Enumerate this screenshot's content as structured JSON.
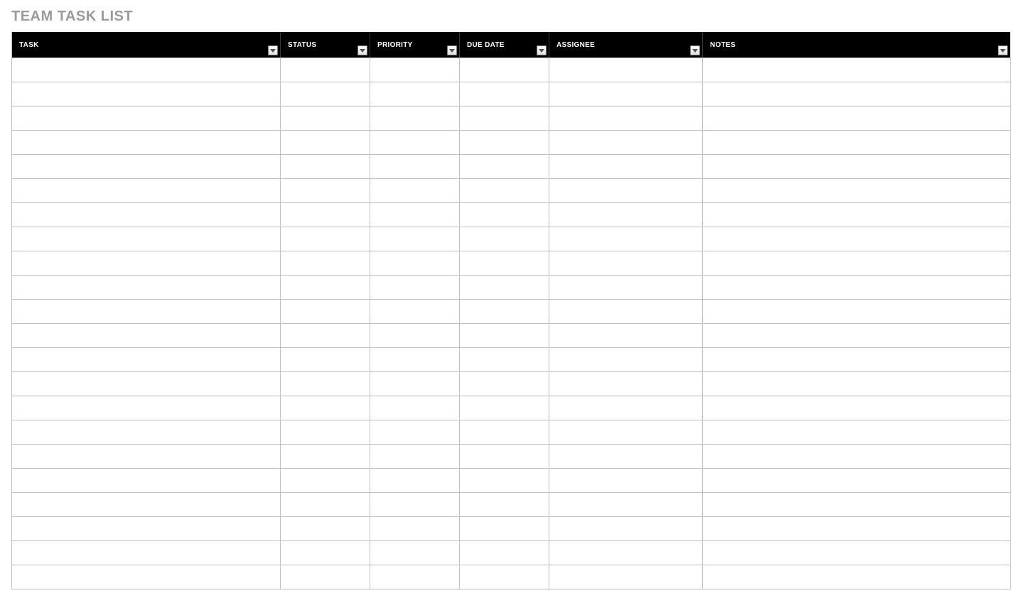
{
  "title": "TEAM TASK LIST",
  "columns": [
    {
      "key": "task",
      "label": "TASK",
      "filter": true
    },
    {
      "key": "status",
      "label": "STATUS",
      "filter": true
    },
    {
      "key": "priority",
      "label": "PRIORITY",
      "filter": true
    },
    {
      "key": "due",
      "label": "DUE DATE",
      "filter": true
    },
    {
      "key": "assignee",
      "label": "ASSIGNEE",
      "filter": true
    },
    {
      "key": "notes",
      "label": "NOTES",
      "filter": true
    }
  ],
  "rows": [
    {
      "task": "",
      "status": "",
      "priority": "",
      "due": "",
      "assignee": "",
      "notes": ""
    },
    {
      "task": "",
      "status": "",
      "priority": "",
      "due": "",
      "assignee": "",
      "notes": ""
    },
    {
      "task": "",
      "status": "",
      "priority": "",
      "due": "",
      "assignee": "",
      "notes": ""
    },
    {
      "task": "",
      "status": "",
      "priority": "",
      "due": "",
      "assignee": "",
      "notes": ""
    },
    {
      "task": "",
      "status": "",
      "priority": "",
      "due": "",
      "assignee": "",
      "notes": ""
    },
    {
      "task": "",
      "status": "",
      "priority": "",
      "due": "",
      "assignee": "",
      "notes": ""
    },
    {
      "task": "",
      "status": "",
      "priority": "",
      "due": "",
      "assignee": "",
      "notes": ""
    },
    {
      "task": "",
      "status": "",
      "priority": "",
      "due": "",
      "assignee": "",
      "notes": ""
    },
    {
      "task": "",
      "status": "",
      "priority": "",
      "due": "",
      "assignee": "",
      "notes": ""
    },
    {
      "task": "",
      "status": "",
      "priority": "",
      "due": "",
      "assignee": "",
      "notes": ""
    },
    {
      "task": "",
      "status": "",
      "priority": "",
      "due": "",
      "assignee": "",
      "notes": ""
    },
    {
      "task": "",
      "status": "",
      "priority": "",
      "due": "",
      "assignee": "",
      "notes": ""
    },
    {
      "task": "",
      "status": "",
      "priority": "",
      "due": "",
      "assignee": "",
      "notes": ""
    },
    {
      "task": "",
      "status": "",
      "priority": "",
      "due": "",
      "assignee": "",
      "notes": ""
    },
    {
      "task": "",
      "status": "",
      "priority": "",
      "due": "",
      "assignee": "",
      "notes": ""
    },
    {
      "task": "",
      "status": "",
      "priority": "",
      "due": "",
      "assignee": "",
      "notes": ""
    },
    {
      "task": "",
      "status": "",
      "priority": "",
      "due": "",
      "assignee": "",
      "notes": ""
    },
    {
      "task": "",
      "status": "",
      "priority": "",
      "due": "",
      "assignee": "",
      "notes": ""
    },
    {
      "task": "",
      "status": "",
      "priority": "",
      "due": "",
      "assignee": "",
      "notes": ""
    },
    {
      "task": "",
      "status": "",
      "priority": "",
      "due": "",
      "assignee": "",
      "notes": ""
    },
    {
      "task": "",
      "status": "",
      "priority": "",
      "due": "",
      "assignee": "",
      "notes": ""
    },
    {
      "task": "",
      "status": "",
      "priority": "",
      "due": "",
      "assignee": "",
      "notes": ""
    }
  ]
}
